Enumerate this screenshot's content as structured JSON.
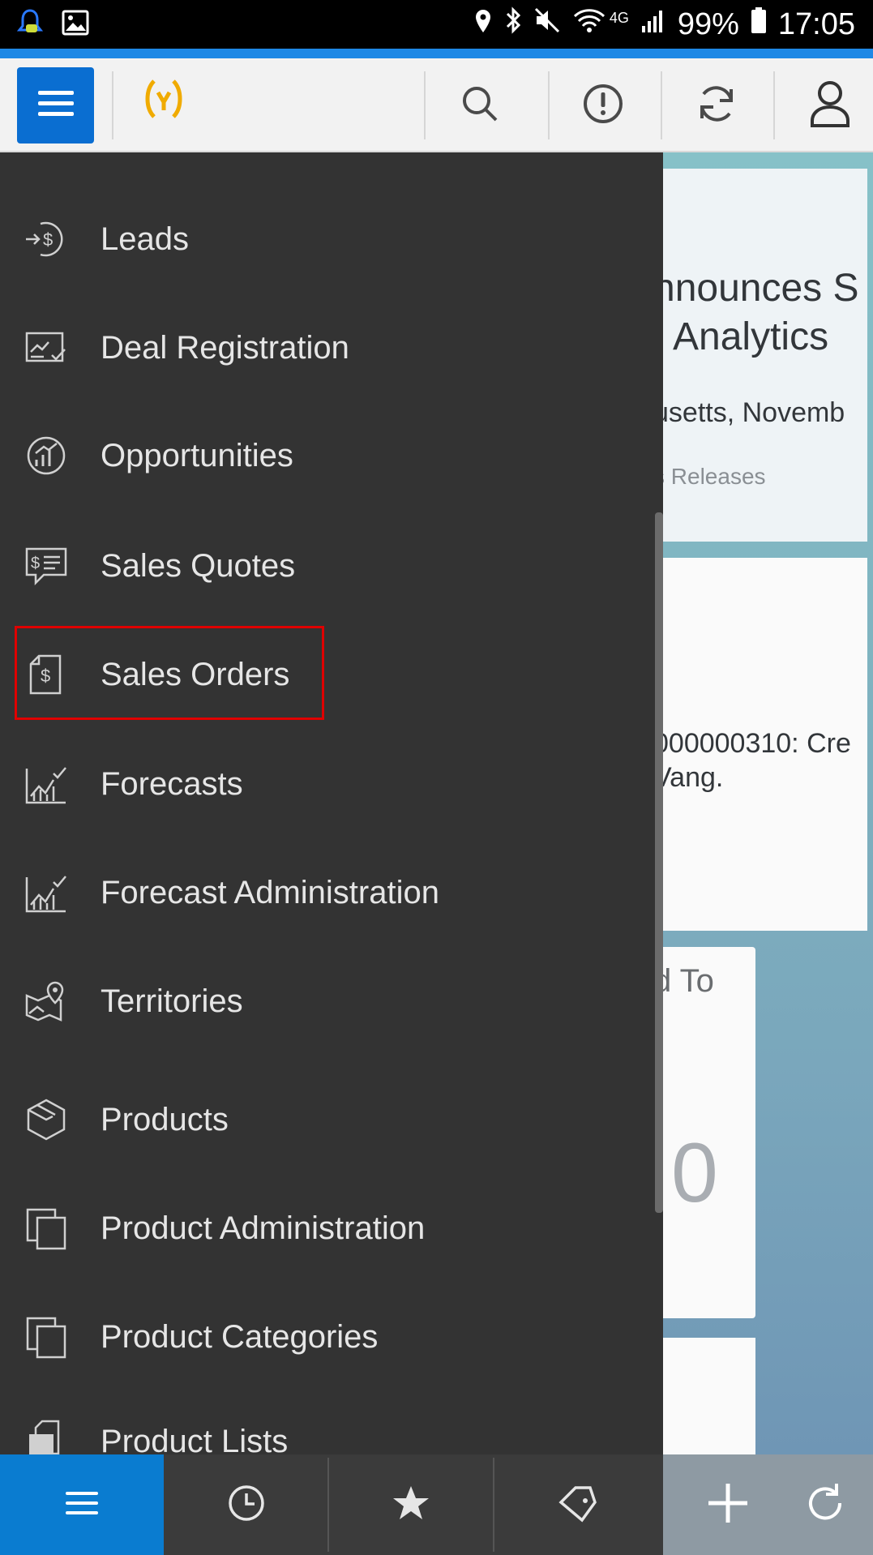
{
  "status_bar": {
    "battery": "99%",
    "time": "17:05",
    "network": "4G"
  },
  "header": {
    "logo": "(ˠ)",
    "icons": [
      "menu-icon",
      "search-icon",
      "alert-icon",
      "sync-icon",
      "user-icon"
    ]
  },
  "drawer": {
    "items": [
      {
        "label": "Leads",
        "icon": "leads-icon"
      },
      {
        "label": "Deal Registration",
        "icon": "deal-registration-icon"
      },
      {
        "label": "Opportunities",
        "icon": "opportunities-icon"
      },
      {
        "label": "Sales Quotes",
        "icon": "sales-quotes-icon"
      },
      {
        "label": "Sales Orders",
        "icon": "sales-orders-icon"
      },
      {
        "label": "Forecasts",
        "icon": "forecasts-icon"
      },
      {
        "label": "Forecast Administration",
        "icon": "forecast-admin-icon"
      },
      {
        "label": "Territories",
        "icon": "territories-icon"
      },
      {
        "label": "Products",
        "icon": "products-icon"
      },
      {
        "label": "Product Administration",
        "icon": "product-admin-icon"
      },
      {
        "label": "Product Categories",
        "icon": "product-categories-icon"
      },
      {
        "label": "Product Lists",
        "icon": "product-lists-icon"
      }
    ],
    "highlighted": "Sales Orders"
  },
  "background": {
    "card1": {
      "line1": "nnounces S",
      "line2": ", Analytics",
      "line3": "usetts, Novemb",
      "line4": "s Releases"
    },
    "card2": {
      "line1": "000000310: Cre",
      "line2": "Vang."
    },
    "card3": {
      "title": "d To",
      "value": "0"
    }
  },
  "bottom_bar": {
    "icons": [
      "menu-icon",
      "recent-icon",
      "favorites-icon",
      "tags-icon",
      "add-icon",
      "refresh-icon"
    ]
  },
  "colors": {
    "accent": "#0a6ed1",
    "drawer_bg": "#333333",
    "highlight_border": "#e00000",
    "logo": "#f0ab00"
  }
}
